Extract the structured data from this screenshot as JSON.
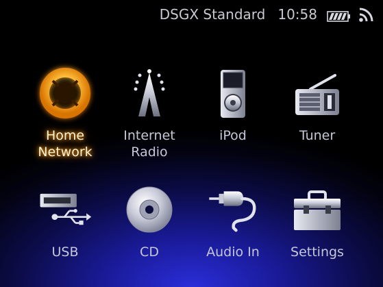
{
  "status": {
    "source": "DSGX Standard",
    "time": "10:58",
    "battery_icon": "battery-full-icon",
    "signal_icon": "wireless-signal-icon"
  },
  "menu": {
    "selected": "Home Network",
    "items": [
      {
        "label_line1": "Home",
        "label_line2": "Network",
        "icon": "home-network-icon",
        "active": true
      },
      {
        "label_line1": "Internet",
        "label_line2": "Radio",
        "icon": "antenna-tower-icon",
        "active": false
      },
      {
        "label_line1": "iPod",
        "label_line2": "",
        "icon": "ipod-icon",
        "active": false
      },
      {
        "label_line1": "Tuner",
        "label_line2": "",
        "icon": "radio-tuner-icon",
        "active": false
      },
      {
        "label_line1": "USB",
        "label_line2": "",
        "icon": "usb-icon",
        "active": false
      },
      {
        "label_line1": "CD",
        "label_line2": "",
        "icon": "cd-disc-icon",
        "active": false
      },
      {
        "label_line1": "Audio In",
        "label_line2": "",
        "icon": "audio-plug-icon",
        "active": false
      },
      {
        "label_line1": "Settings",
        "label_line2": "",
        "icon": "toolbox-icon",
        "active": false
      }
    ]
  }
}
